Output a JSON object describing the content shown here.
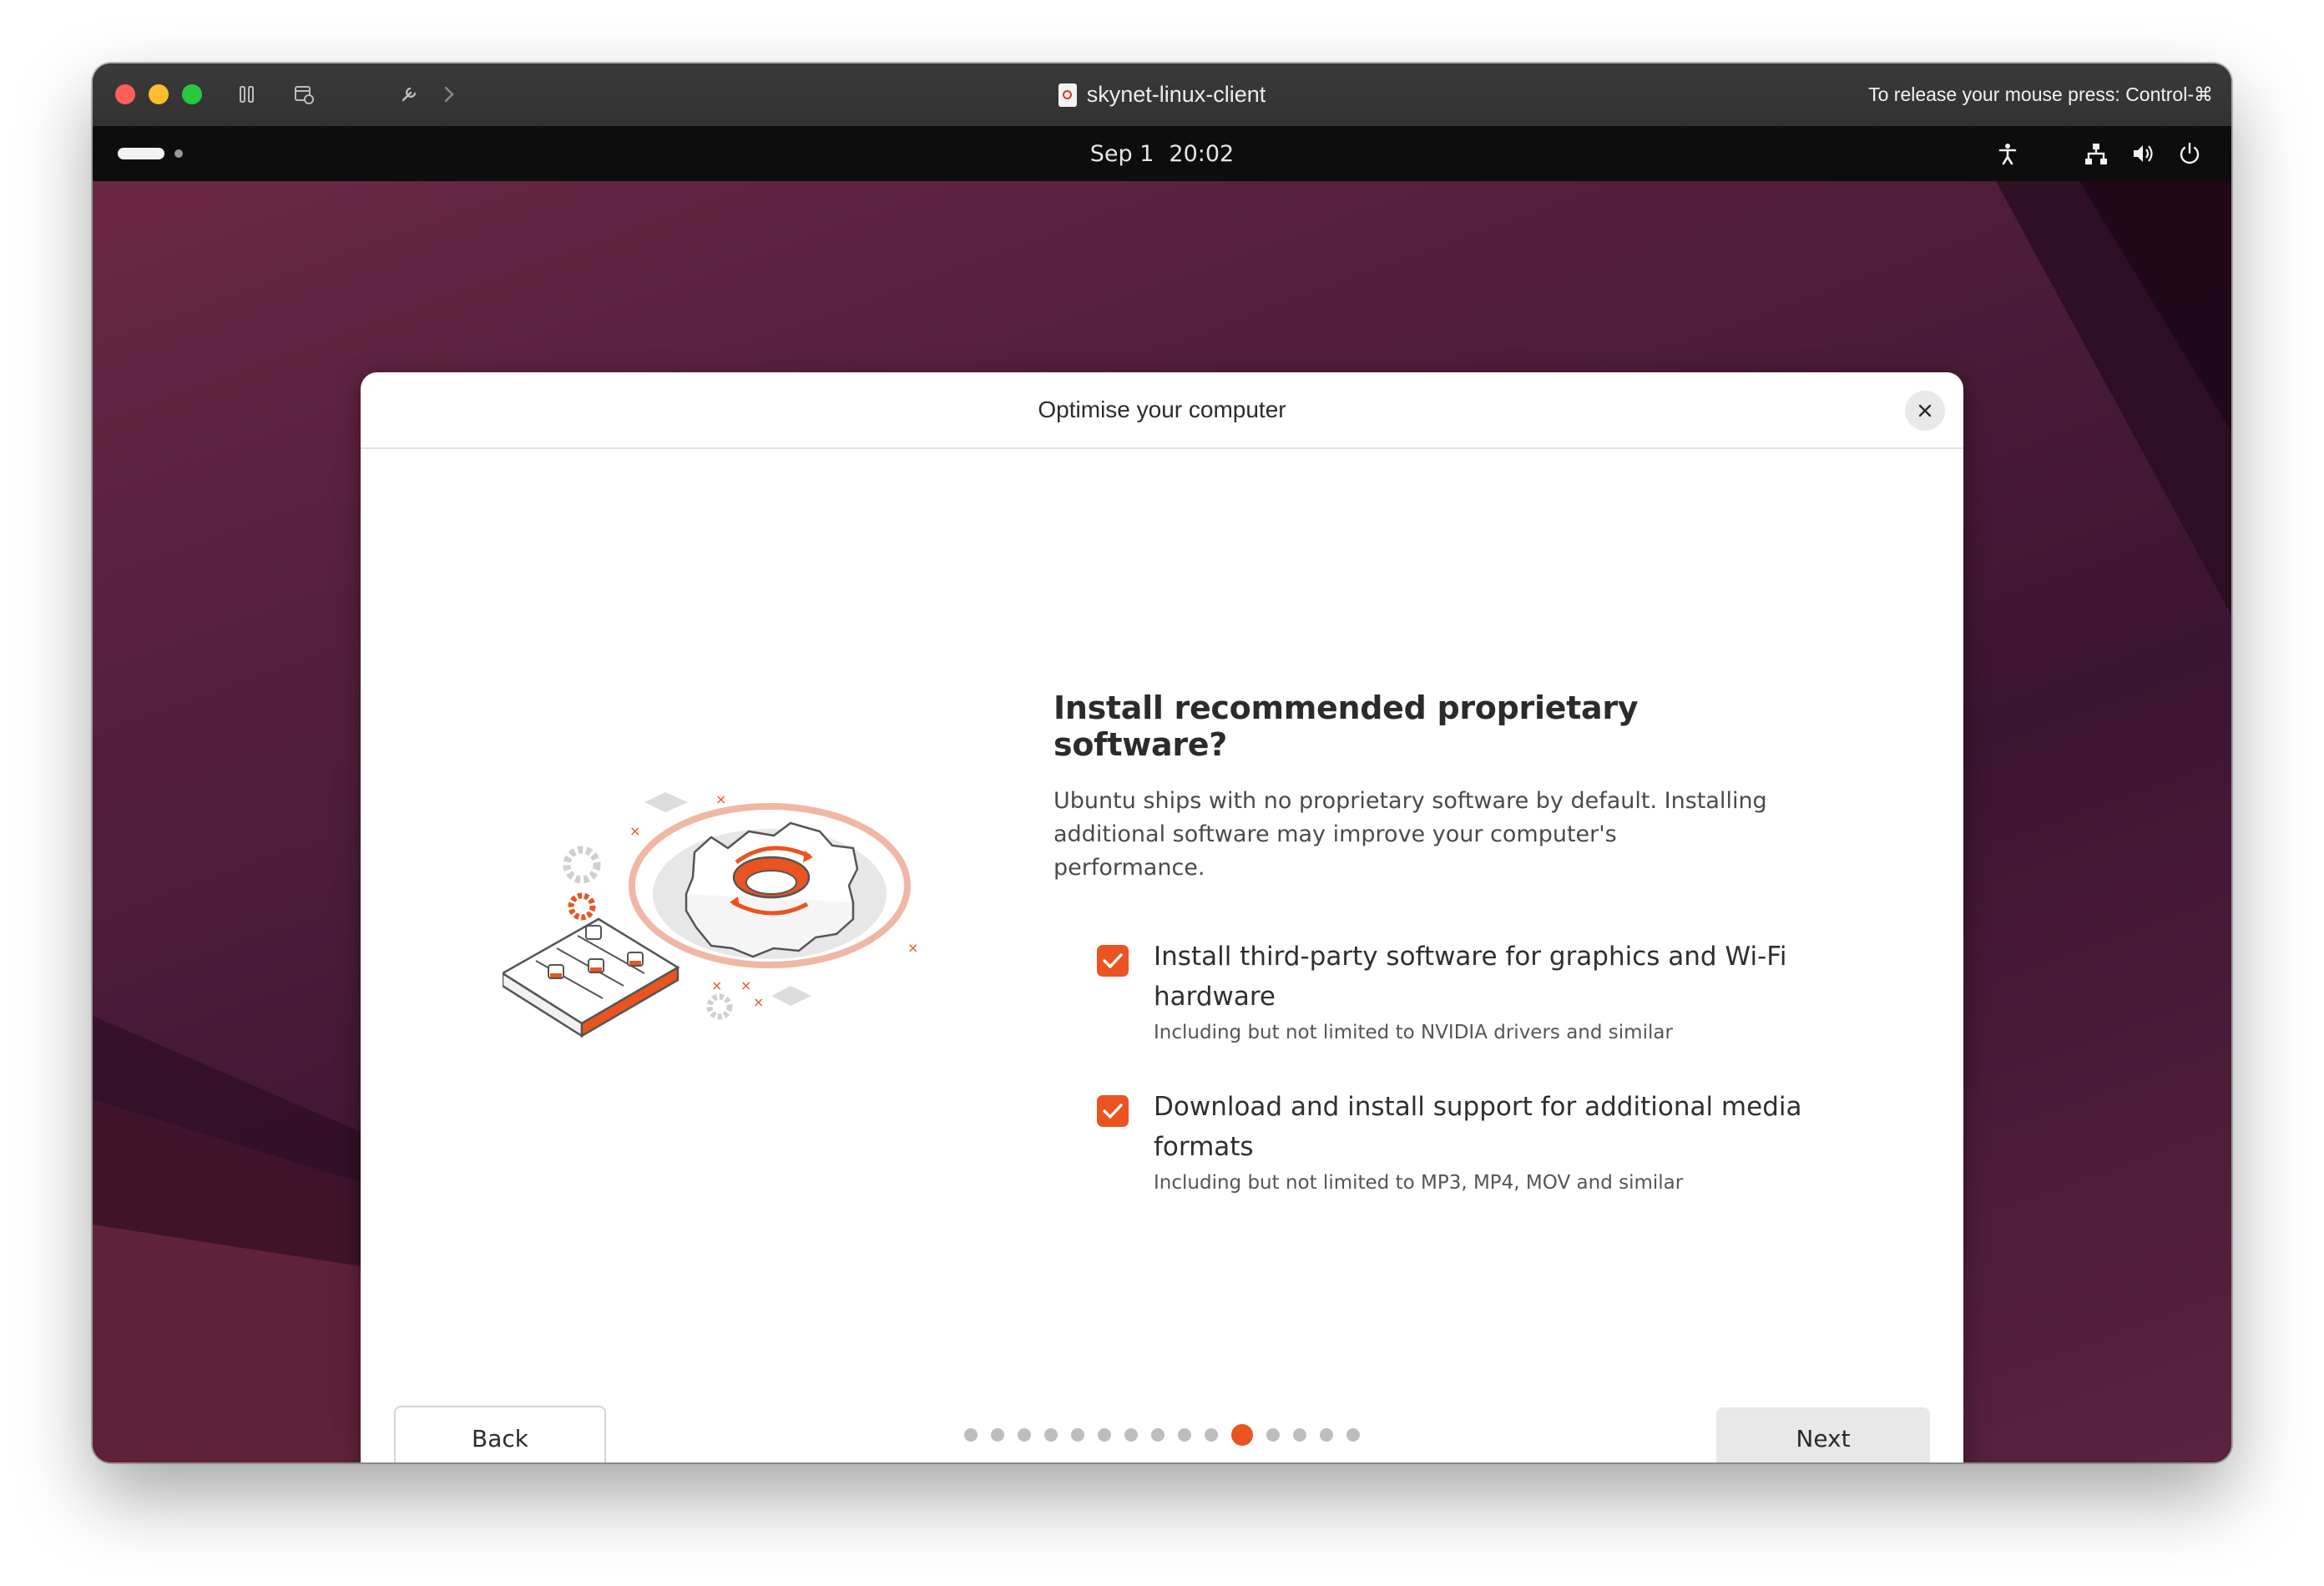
{
  "mac_window": {
    "title": "skynet-linux-client",
    "release_hint": "To release your mouse press: Control-⌘"
  },
  "top_bar": {
    "date": "Sep 1",
    "time": "20:02"
  },
  "dialog": {
    "title": "Optimise your computer",
    "heading": "Install recommended proprietary software?",
    "description": "Ubuntu ships with no proprietary software by default. Installing additional software may improve your computer's performance.",
    "options": [
      {
        "label": "Install third-party software for graphics and Wi-Fi hardware",
        "sublabel": "Including but not limited to NVIDIA drivers and similar",
        "checked": true
      },
      {
        "label": "Download and install support for additional media formats",
        "sublabel": "Including but not limited to MP3, MP4, MOV and similar",
        "checked": true
      }
    ],
    "back_label": "Back",
    "next_label": "Next",
    "pager": {
      "total_steps": 15,
      "current_step": 11
    }
  },
  "colors": {
    "accent": "#e95420",
    "desktop": "#4e1d3a"
  }
}
